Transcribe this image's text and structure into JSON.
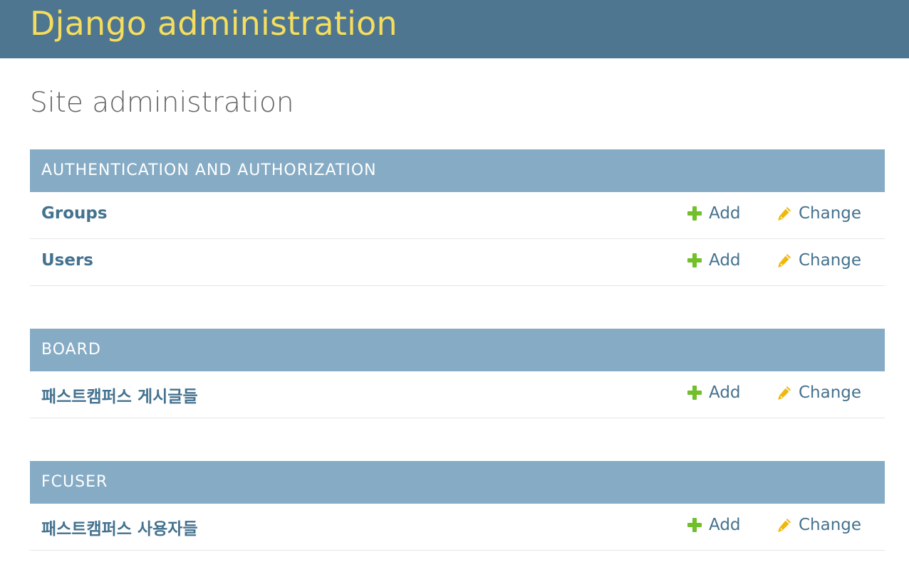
{
  "header": {
    "site_name": "Django administration"
  },
  "content": {
    "title": "Site administration"
  },
  "actions": {
    "add_label": "Add",
    "change_label": "Change"
  },
  "modules": [
    {
      "caption": "AUTHENTICATION AND AUTHORIZATION",
      "rows": [
        {
          "label": "Groups"
        },
        {
          "label": "Users"
        }
      ]
    },
    {
      "caption": "BOARD",
      "rows": [
        {
          "label": "패스트캠퍼스 게시글들"
        }
      ]
    },
    {
      "caption": "FCUSER",
      "rows": [
        {
          "label": "패스트캠퍼스 사용자들"
        }
      ]
    }
  ],
  "colors": {
    "header_bg": "#4f7690",
    "branding_text": "#f5dd5d",
    "caption_bg": "#86abc5",
    "link": "#44728f",
    "add_icon": "#70bf2b",
    "change_icon": "#efb80b"
  },
  "icons": {
    "add": "plus-icon",
    "change": "pencil-icon"
  }
}
